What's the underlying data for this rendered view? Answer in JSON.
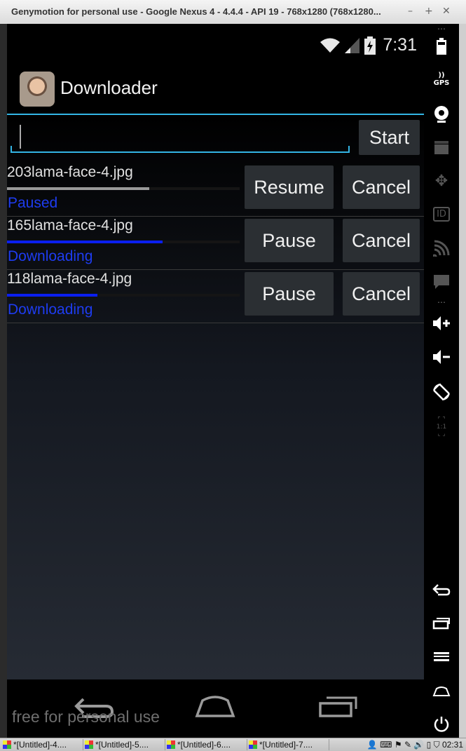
{
  "window": {
    "title": "Genymotion for personal use - Google Nexus 4 - 4.4.4 - API 19 - 768x1280 (768x1280..."
  },
  "statusbar": {
    "clock": "7:31"
  },
  "app": {
    "title": "Downloader"
  },
  "url_input": {
    "value": "",
    "placeholder": ""
  },
  "start_label": "Start",
  "downloads": [
    {
      "name": "203lama-face-4.jpg",
      "status": "Paused",
      "progress": 0.61,
      "action": "Resume",
      "cancel": "Cancel"
    },
    {
      "name": "165lama-face-4.jpg",
      "status": "Downloading",
      "progress": 0.67,
      "action": "Pause",
      "cancel": "Cancel"
    },
    {
      "name": "118lama-face-4.jpg",
      "status": "Downloading",
      "progress": 0.39,
      "action": "Pause",
      "cancel": "Cancel"
    }
  ],
  "watermark": "free for personal use",
  "side_icons": [
    "battery-icon",
    "gps-icon",
    "camera-icon",
    "video-icon",
    "dpad-icon",
    "id-icon",
    "cast-icon",
    "message-icon",
    "volume-up-icon",
    "volume-down-icon",
    "rotate-icon",
    "pixel-perfect-icon",
    "back-icon",
    "recent-apps-icon",
    "menu-icon",
    "home-icon",
    "power-icon"
  ],
  "side_labels": {
    "gps": "GPS",
    "id": "ID",
    "pixel": "1:1"
  },
  "taskbar": {
    "tasks": [
      "*[Untitled]-4....",
      "*[Untitled]-5....",
      "*[Untitled]-6....",
      "*[Untitled]-7...."
    ],
    "clock": "02:31"
  },
  "colors": {
    "accent": "#33b5e5",
    "status_text": "#1e3cf0",
    "progress_paused": "#9a9a9a",
    "progress_active": "#0a1ff0"
  }
}
